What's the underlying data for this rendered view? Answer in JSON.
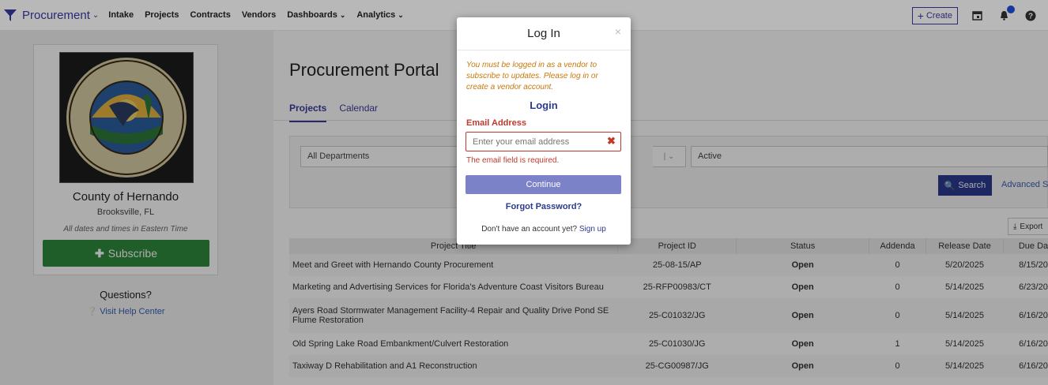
{
  "nav": {
    "brand": "Procurement",
    "items": [
      {
        "label": "Intake",
        "caret": false
      },
      {
        "label": "Projects",
        "caret": false
      },
      {
        "label": "Contracts",
        "caret": false
      },
      {
        "label": "Vendors",
        "caret": false
      },
      {
        "label": "Dashboards",
        "caret": true
      },
      {
        "label": "Analytics",
        "caret": true
      }
    ],
    "create_label": "Create"
  },
  "org": {
    "name": "County of Hernando",
    "city": "Brooksville, FL",
    "timezone_note": "All dates and times in Eastern Time",
    "seal_text_top": "HERNANDO COUNTY",
    "seal_text_bottom": "FLORIDA",
    "subscribe_label": "Subscribe",
    "questions_label": "Questions?",
    "help_label": "Visit Help Center"
  },
  "main": {
    "title": "Procurement Portal",
    "tabs": [
      "Projects",
      "Calendar"
    ],
    "department_select": "All Departments",
    "status_select": "Active",
    "search_label": "Search",
    "advanced_search_label": "Advanced Se",
    "export_label": "Export"
  },
  "table": {
    "headers": [
      "Project Title",
      "Project ID",
      "Status",
      "Addenda",
      "Release Date",
      "Due Da"
    ],
    "rows": [
      {
        "title": "Meet and Greet with Hernando County Procurement",
        "id": "25-08-15/AP",
        "status": "Open",
        "addenda": "0",
        "release": "5/20/2025",
        "due": "8/15/20"
      },
      {
        "title": "Marketing and Advertising Services for Florida's Adventure Coast Visitors Bureau",
        "id": "25-RFP00983/CT",
        "status": "Open",
        "addenda": "0",
        "release": "5/14/2025",
        "due": "6/23/20"
      },
      {
        "title": "Ayers Road Stormwater Management Facility-4 Repair and Quality Drive Pond SE Flume Restoration",
        "id": "25-C01032/JG",
        "status": "Open",
        "addenda": "0",
        "release": "5/14/2025",
        "due": "6/16/20"
      },
      {
        "title": "Old Spring Lake Road Embankment/Culvert Restoration",
        "id": "25-C01030/JG",
        "status": "Open",
        "addenda": "1",
        "release": "5/14/2025",
        "due": "6/16/20"
      },
      {
        "title": "Taxiway D Rehabilitation and A1 Reconstruction",
        "id": "25-CG00987/JG",
        "status": "Open",
        "addenda": "0",
        "release": "5/14/2025",
        "due": "6/16/20"
      }
    ]
  },
  "modal": {
    "title": "Log In",
    "close": "×",
    "note": "You must be logged in as a vendor to subscribe to updates. Please log in or create a vendor account.",
    "login_heading": "Login",
    "email_label": "Email Address",
    "email_placeholder": "Enter your email address",
    "email_value": "",
    "email_error": "The email field is required.",
    "continue_label": "Continue",
    "forgot_label": "Forgot Password?",
    "signup_prompt": "Don't have an account yet?",
    "signup_link": "Sign up"
  },
  "colors": {
    "brand": "#3a3aa0",
    "success": "#2f8a3d",
    "error": "#c0392b",
    "warning": "#c8780a"
  }
}
